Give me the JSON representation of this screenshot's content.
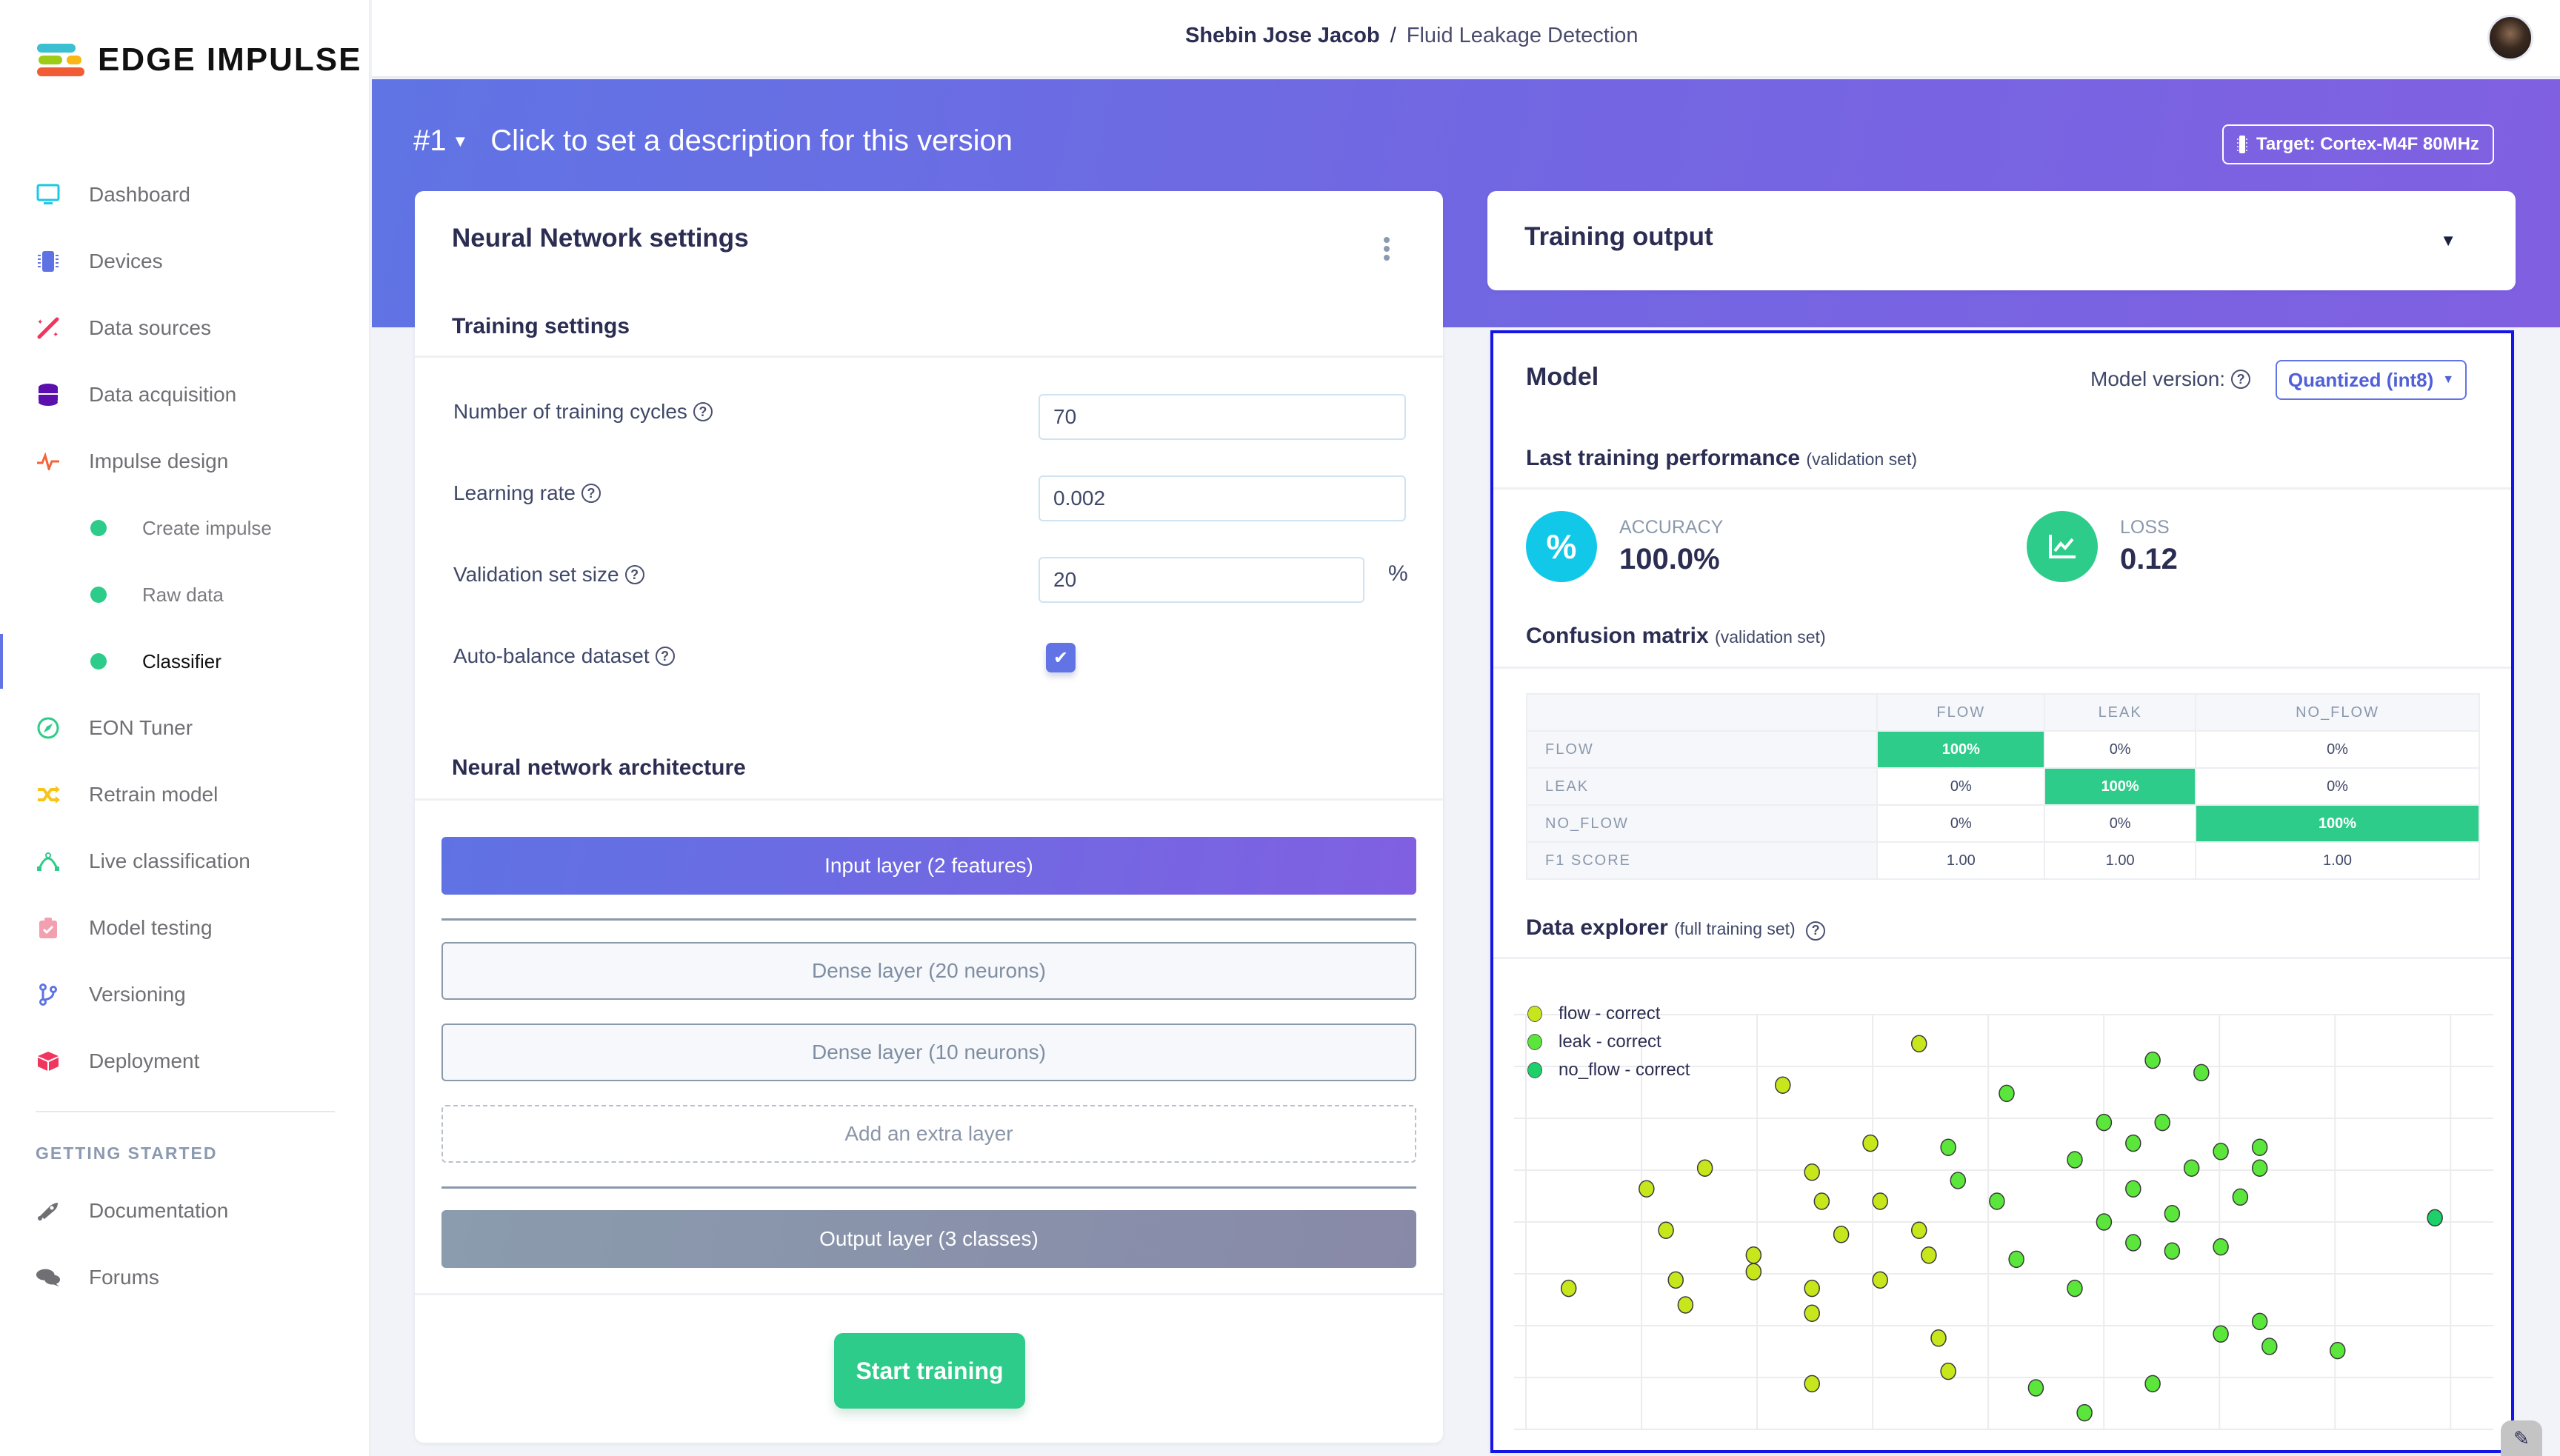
{
  "brand": {
    "name": "EDGE IMPULSE",
    "logo_colors": [
      "#3bbfd1",
      "#9ccc18",
      "#f9b614",
      "#f25c34"
    ]
  },
  "sidebar": {
    "items": [
      {
        "label": "Dashboard",
        "icon": "monitor-icon",
        "color": "#1ec8e6"
      },
      {
        "label": "Devices",
        "icon": "chip-icon",
        "color": "#5f72e4"
      },
      {
        "label": "Data sources",
        "icon": "magic-wand-icon",
        "color": "#f0365e"
      },
      {
        "label": "Data acquisition",
        "icon": "database-icon",
        "color": "#5b0fad"
      },
      {
        "label": "Impulse design",
        "icon": "pulse-icon",
        "color": "#f5633a"
      }
    ],
    "sub_items": [
      {
        "label": "Create impulse"
      },
      {
        "label": "Raw data"
      },
      {
        "label": "Classifier",
        "active": true
      }
    ],
    "items_after": [
      {
        "label": "EON Tuner",
        "icon": "compass-icon",
        "color": "#2ecc8a"
      },
      {
        "label": "Retrain model",
        "icon": "shuffle-icon",
        "color": "#f7c51a"
      },
      {
        "label": "Live classification",
        "icon": "bezier-icon",
        "color": "#2ecc8a"
      },
      {
        "label": "Model testing",
        "icon": "clipboard-check-icon",
        "color": "#f2a0b0"
      },
      {
        "label": "Versioning",
        "icon": "git-branch-icon",
        "color": "#5f72e4"
      },
      {
        "label": "Deployment",
        "icon": "cube-icon",
        "color": "#f0365e"
      }
    ],
    "getting_started_heading": "GETTING STARTED",
    "getting_started": [
      {
        "label": "Documentation",
        "icon": "rocket-icon",
        "color": "#6f6f74"
      },
      {
        "label": "Forums",
        "icon": "chat-bubbles-icon",
        "color": "#6f6f74"
      }
    ]
  },
  "header": {
    "user": "Shebin Jose Jacob",
    "separator": "/",
    "project": "Fluid Leakage Detection"
  },
  "hero": {
    "version": "#1",
    "description_placeholder": "Click to set a description for this version",
    "target_label": "Target: Cortex-M4F 80MHz"
  },
  "nn_settings": {
    "title": "Neural Network settings",
    "training_settings_heading": "Training settings",
    "fields": {
      "cycles": {
        "label": "Number of training cycles",
        "value": "70"
      },
      "learning_rate": {
        "label": "Learning rate",
        "value": "0.002"
      },
      "validation": {
        "label": "Validation set size",
        "value": "20",
        "unit": "%"
      },
      "auto_balance": {
        "label": "Auto-balance dataset",
        "checked": true
      }
    },
    "architecture_heading": "Neural network architecture",
    "layers": {
      "input": "Input layer (2 features)",
      "dense1": "Dense layer (20 neurons)",
      "dense2": "Dense layer (10 neurons)",
      "add": "Add an extra layer",
      "output": "Output layer (3 classes)"
    },
    "start_button": "Start training"
  },
  "training_output": {
    "title": "Training output"
  },
  "model": {
    "title": "Model",
    "version_label": "Model version:",
    "version_value": "Quantized (int8)",
    "performance_heading": "Last training performance",
    "performance_note": "(validation set)",
    "accuracy": {
      "label": "ACCURACY",
      "value": "100.0%",
      "color": "#12c8e8"
    },
    "loss": {
      "label": "LOSS",
      "value": "0.12",
      "color": "#2ecc8a"
    },
    "confusion_heading": "Confusion matrix",
    "confusion_note": "(validation set)",
    "confusion": {
      "columns": [
        "FLOW",
        "LEAK",
        "NO_FLOW"
      ],
      "rows": [
        {
          "label": "FLOW",
          "cells": [
            "100%",
            "0%",
            "0%"
          ],
          "hit": 0
        },
        {
          "label": "LEAK",
          "cells": [
            "0%",
            "100%",
            "0%"
          ],
          "hit": 1
        },
        {
          "label": "NO_FLOW",
          "cells": [
            "0%",
            "0%",
            "100%"
          ],
          "hit": 2
        },
        {
          "label": "F1 SCORE",
          "cells": [
            "1.00",
            "1.00",
            "1.00"
          ],
          "hit": -1
        }
      ]
    },
    "explorer_heading": "Data explorer",
    "explorer_note": "(full training set)"
  },
  "chart_data": {
    "type": "scatter",
    "title": "Data explorer (full training set)",
    "xlabel": "",
    "ylabel": "",
    "xlim": [
      0,
      100
    ],
    "ylim": [
      0,
      100
    ],
    "grid": true,
    "legend_position": "top-left",
    "series": [
      {
        "name": "flow - correct",
        "color": "#c8e61c",
        "points": [
          [
            41,
            93
          ],
          [
            27,
            83
          ],
          [
            36,
            69
          ],
          [
            19,
            63
          ],
          [
            13,
            58
          ],
          [
            30,
            62
          ],
          [
            31,
            55
          ],
          [
            37,
            55
          ],
          [
            15,
            48
          ],
          [
            33,
            47
          ],
          [
            41,
            48
          ],
          [
            24,
            42
          ],
          [
            42,
            42
          ],
          [
            16,
            36
          ],
          [
            5,
            34
          ],
          [
            24,
            38
          ],
          [
            30,
            34
          ],
          [
            37,
            36
          ],
          [
            17,
            30
          ],
          [
            30,
            28
          ],
          [
            43,
            22
          ],
          [
            44,
            14
          ],
          [
            30,
            11
          ]
        ]
      },
      {
        "name": "leak - correct",
        "color": "#5ae63a",
        "points": [
          [
            65,
            89
          ],
          [
            70,
            86
          ],
          [
            50,
            81
          ],
          [
            60,
            74
          ],
          [
            66,
            74
          ],
          [
            44,
            68
          ],
          [
            57,
            65
          ],
          [
            63,
            69
          ],
          [
            72,
            67
          ],
          [
            76,
            68
          ],
          [
            45,
            60
          ],
          [
            69,
            63
          ],
          [
            76,
            63
          ],
          [
            49,
            55
          ],
          [
            63,
            58
          ],
          [
            74,
            56
          ],
          [
            67,
            52
          ],
          [
            60,
            50
          ],
          [
            63,
            45
          ],
          [
            67,
            43
          ],
          [
            72,
            44
          ],
          [
            51,
            41
          ],
          [
            57,
            34
          ],
          [
            76,
            26
          ],
          [
            72,
            23
          ],
          [
            77,
            20
          ],
          [
            84,
            19
          ],
          [
            53,
            10
          ],
          [
            65,
            11
          ],
          [
            58,
            4
          ]
        ]
      },
      {
        "name": "no_flow - correct",
        "color": "#1cd16a",
        "points": [
          [
            94,
            51
          ]
        ]
      }
    ]
  }
}
